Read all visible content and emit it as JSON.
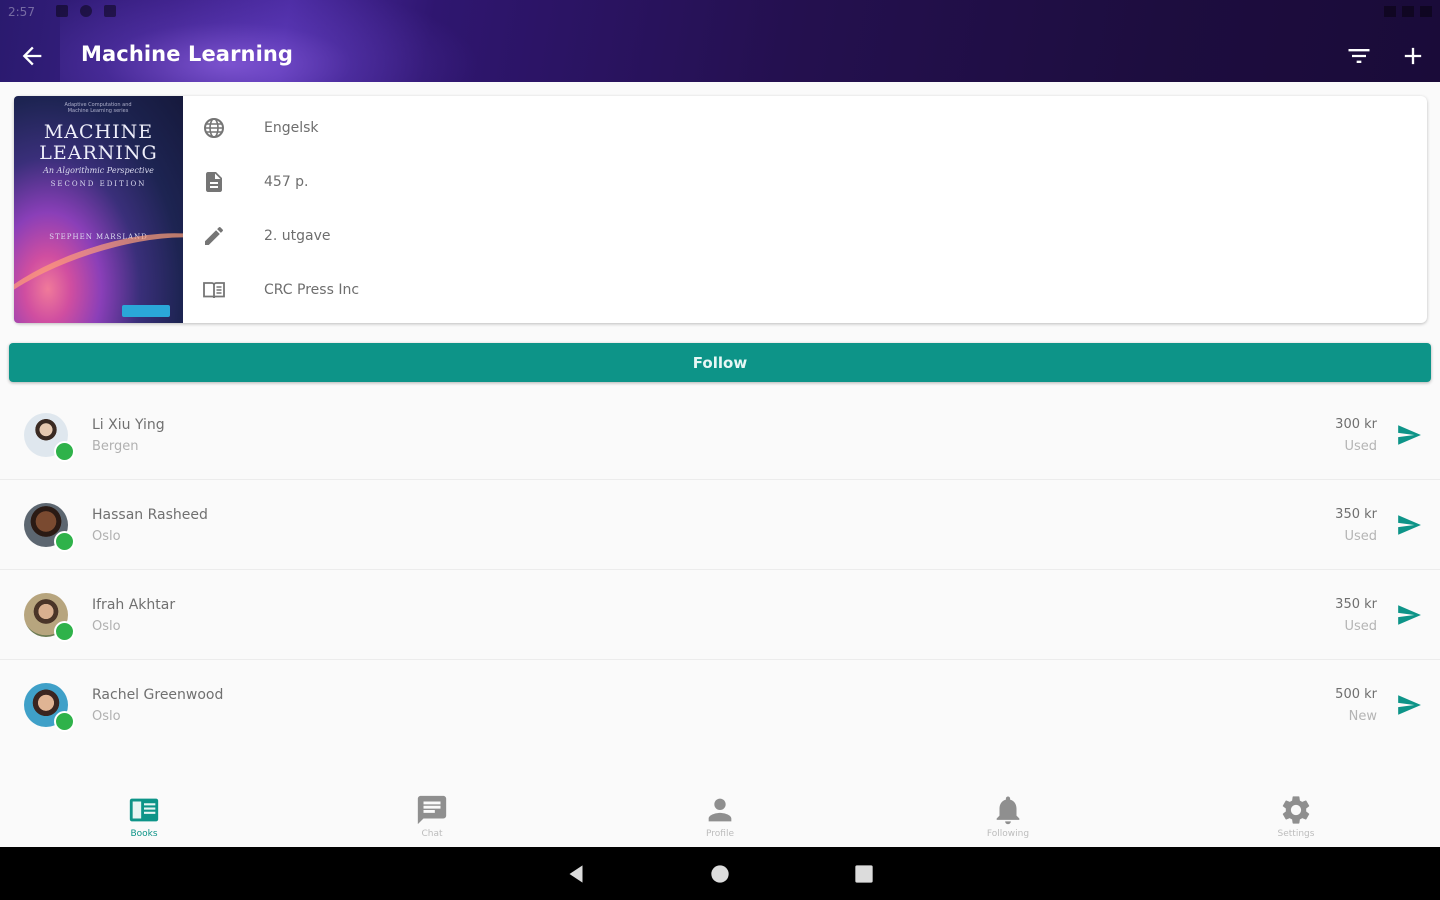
{
  "status_bar": {
    "time": "2:57"
  },
  "header": {
    "title": "Machine Learning"
  },
  "book": {
    "cover": {
      "top_line_1": "Adaptive Computation and",
      "top_line_2": "Machine Learning series",
      "title_line_1": "MACHINE",
      "title_line_2": "LEARNING",
      "subtitle": "An Algorithmic Perspective",
      "edition": "SECOND EDITION",
      "author": "STEPHEN MARSLAND"
    },
    "language": "Engelsk",
    "pages": "457 p.",
    "edition": "2. utgave",
    "publisher": "CRC Press Inc"
  },
  "follow_label": "Follow",
  "sellers": [
    {
      "name": "Li Xiu Ying",
      "city": "Bergen",
      "price": "300 kr",
      "condition": "Used"
    },
    {
      "name": "Hassan Rasheed",
      "city": "Oslo",
      "price": "350 kr",
      "condition": "Used"
    },
    {
      "name": "Ifrah Akhtar",
      "city": "Oslo",
      "price": "350 kr",
      "condition": "Used"
    },
    {
      "name": "Rachel Greenwood",
      "city": "Oslo",
      "price": "500 kr",
      "condition": "New"
    }
  ],
  "bottom_nav": [
    {
      "label": "Books",
      "icon": "book-icon",
      "active": true
    },
    {
      "label": "Chat",
      "icon": "chat-icon",
      "active": false
    },
    {
      "label": "Profile",
      "icon": "person-icon",
      "active": false
    },
    {
      "label": "Following",
      "icon": "bell-icon",
      "active": false
    },
    {
      "label": "Settings",
      "icon": "gear-icon",
      "active": false
    }
  ],
  "colors": {
    "accent": "#0d9488",
    "header": "#24104f",
    "online": "#2fb24a"
  }
}
